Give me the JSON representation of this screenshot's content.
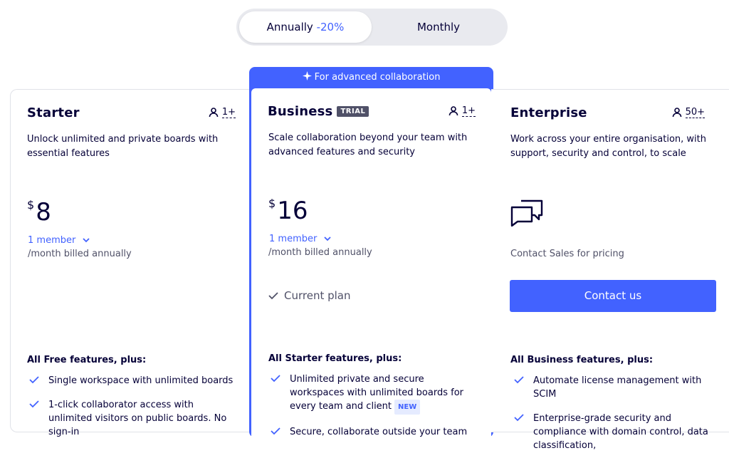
{
  "billing_toggle": {
    "annual_label": "Annually",
    "annual_discount": "-20%",
    "monthly_label": "Monthly"
  },
  "plans": {
    "starter": {
      "title": "Starter",
      "seats": "1+",
      "description": "Unlock unlimited and private boards with essential features",
      "currency": "$",
      "price": "8",
      "members": "1 member",
      "billed": "/month billed annually",
      "features_head": "All Free features, plus:",
      "features": [
        "Single workspace with unlimited boards",
        "1-click collaborator access with unlimited visitors on public boards. No sign-in"
      ]
    },
    "business": {
      "banner": "For advanced collaboration",
      "title": "Business",
      "badge": "TRIAL",
      "seats": "1+",
      "description": "Scale collaboration beyond your team with advanced features and security",
      "currency": "$",
      "price": "16",
      "members": "1 member",
      "billed": "/month billed annually",
      "current_plan": "Current plan",
      "features_head": "All Starter features, plus:",
      "features": [
        "Unlimited private and secure workspaces with unlimited boards for every team and client",
        "Secure, collaborate outside your team"
      ],
      "new_badge": "NEW"
    },
    "enterprise": {
      "title": "Enterprise",
      "seats": "50+",
      "description": "Work across your entire organisation, with support, security and control, to scale",
      "contact_text": "Contact Sales for pricing",
      "contact_button": "Contact us",
      "features_head": "All Business features, plus:",
      "features": [
        "Automate license management with SCIM",
        "Enterprise-grade security and compliance with domain control, data classification,"
      ]
    }
  },
  "colors": {
    "accent": "#4262ff",
    "text": "#050038",
    "muted": "#505168"
  }
}
